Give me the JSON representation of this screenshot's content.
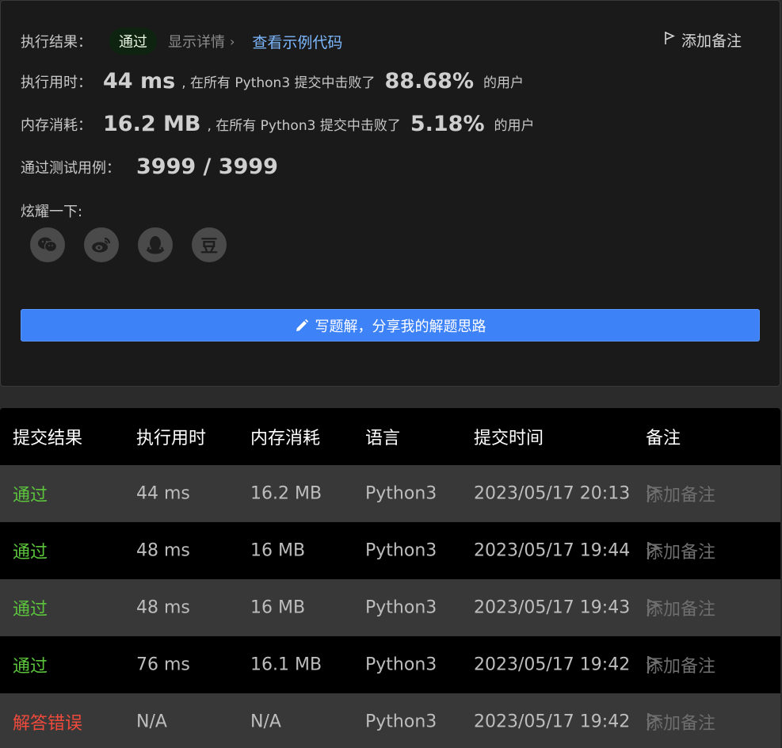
{
  "result": {
    "label": "执行结果：",
    "status": "通过",
    "details_link": "显示详情",
    "example_code_link": "查看示例代码",
    "add_note": "添加备注"
  },
  "runtime": {
    "label": "执行用时：",
    "value": "44 ms",
    "mid_text": ", 在所有 Python3 提交中击败了",
    "percent": "88.68%",
    "tail": "的用户"
  },
  "memory": {
    "label": "内存消耗：",
    "value": "16.2 MB",
    "mid_text": ", 在所有 Python3 提交中击败了",
    "percent": "5.18%",
    "tail": "的用户"
  },
  "tests": {
    "label": "通过测试用例：",
    "value": "3999 / 3999"
  },
  "share": {
    "label": "炫耀一下:",
    "icons": [
      "wechat-icon",
      "weibo-icon",
      "qq-icon",
      "douban-icon"
    ],
    "douban_glyph": "豆"
  },
  "write_button": "写题解，分享我的解题思路",
  "colors": {
    "accent": "#3e82f7",
    "pass": "#5cc43c",
    "error": "#ef4a3c",
    "link": "#7db8ff"
  },
  "table": {
    "headers": [
      "提交结果",
      "执行用时",
      "内存消耗",
      "语言",
      "提交时间",
      "备注"
    ],
    "rows": [
      {
        "status": "通过",
        "time": "44 ms",
        "memory": "16.2 MB",
        "lang": "Python3",
        "submitted": "2023/05/17 20:13",
        "note": "添加备注"
      },
      {
        "status": "通过",
        "time": "48 ms",
        "memory": "16 MB",
        "lang": "Python3",
        "submitted": "2023/05/17 19:44",
        "note": "添加备注"
      },
      {
        "status": "通过",
        "time": "48 ms",
        "memory": "16 MB",
        "lang": "Python3",
        "submitted": "2023/05/17 19:43",
        "note": "添加备注"
      },
      {
        "status": "通过",
        "time": "76 ms",
        "memory": "16.1 MB",
        "lang": "Python3",
        "submitted": "2023/05/17 19:42",
        "note": "添加备注"
      },
      {
        "status": "解答错误",
        "time": "N/A",
        "memory": "N/A",
        "lang": "Python3",
        "submitted": "2023/05/17 19:42",
        "note": "添加备注"
      }
    ]
  }
}
